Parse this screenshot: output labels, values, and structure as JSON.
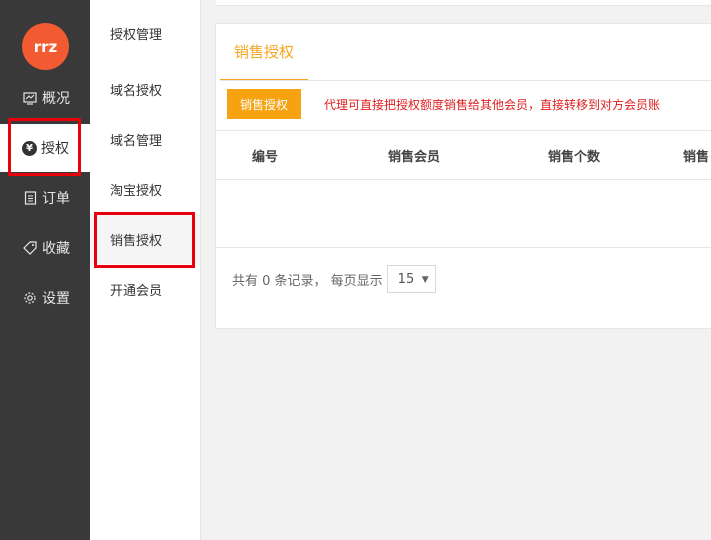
{
  "logo": {
    "text": "rrz"
  },
  "left_nav": [
    {
      "label": "概况",
      "icon": "dashboard-icon"
    },
    {
      "label": "授权",
      "icon": "yen-icon"
    },
    {
      "label": "订单",
      "icon": "document-icon"
    },
    {
      "label": "收藏",
      "icon": "tag-icon"
    },
    {
      "label": "设置",
      "icon": "gear-icon"
    }
  ],
  "left_nav_active": "授权",
  "sub_nav": [
    {
      "label": "授权管理"
    },
    {
      "label": "域名授权"
    },
    {
      "label": "域名管理"
    },
    {
      "label": "淘宝授权"
    },
    {
      "label": "销售授权"
    },
    {
      "label": "开通会员"
    }
  ],
  "sub_nav_active": "销售授权",
  "main": {
    "tab_label": "销售授权",
    "action_button": "销售授权",
    "notice": "代理可直接把授权额度销售给其他会员，直接转移到对方会员账",
    "table_headers": [
      "编号",
      "销售会员",
      "销售个数",
      "销售"
    ],
    "pager": {
      "prefix": "共有 0 条记录， 每页显示",
      "page_size": "15"
    }
  },
  "colors": {
    "accent": "#f5a623",
    "sidebar_bg": "#393939",
    "logo_bg": "#f25a32",
    "notice_text": "#e02020",
    "highlight_border": "#e8000b"
  }
}
